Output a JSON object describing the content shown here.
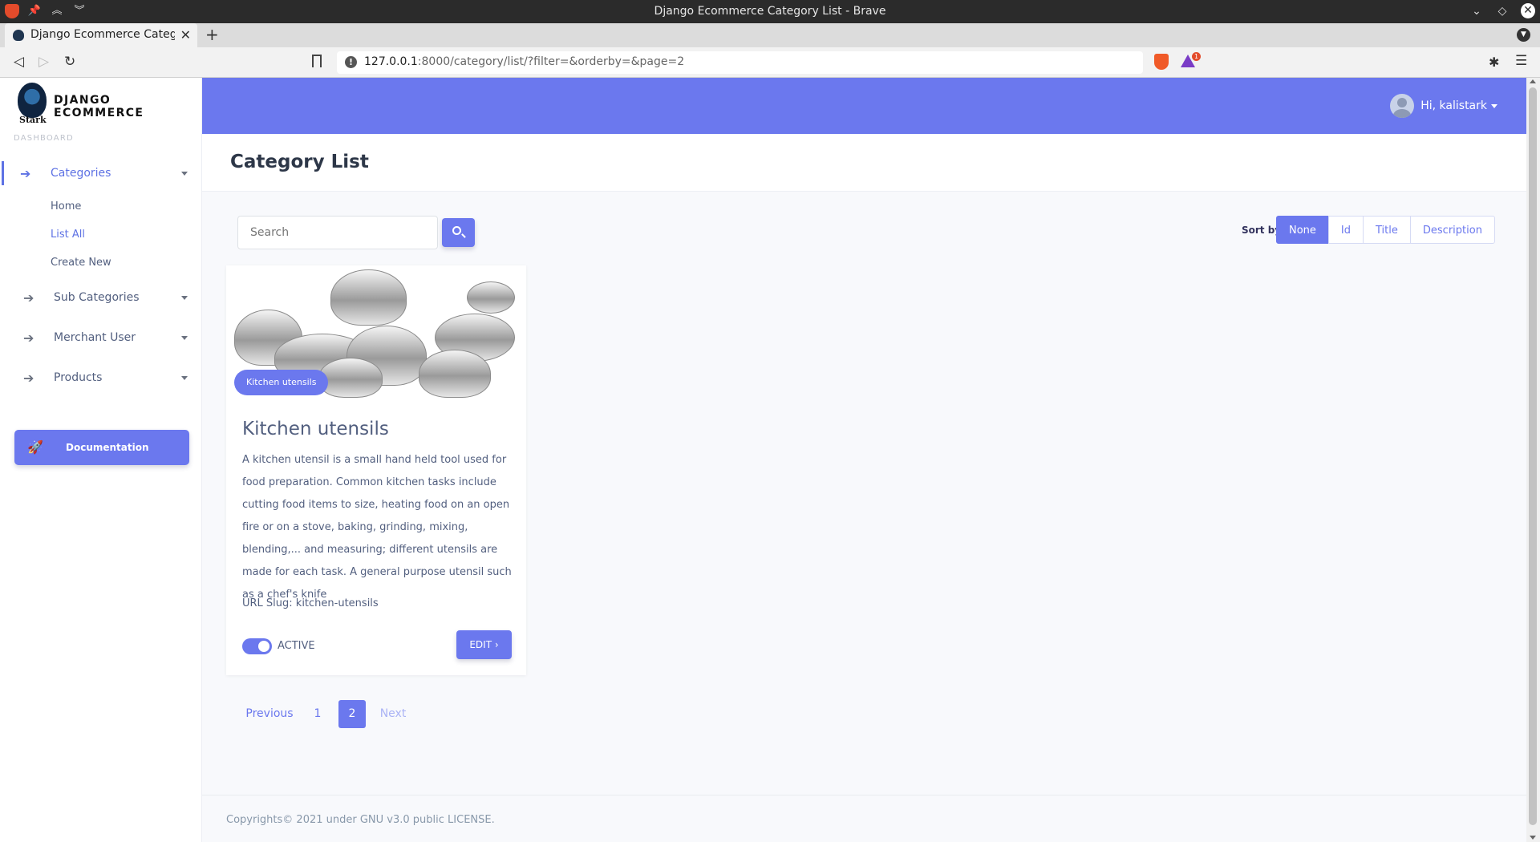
{
  "window": {
    "title": "Django Ecommerce Category List - Brave"
  },
  "tab": {
    "label": "Django Ecommerce Categor",
    "close": "✕",
    "new": "+"
  },
  "address": {
    "host": "127.0.0.1",
    "rest": ":8000/category/list/?filter=&orderby=&page=2",
    "rewards_badge": "1"
  },
  "brand": {
    "name": "DJANGO ECOMMERCE",
    "logo_text": "Stark"
  },
  "sidebar": {
    "section_label": "DASHBOARD",
    "items": [
      {
        "label": "Categories",
        "icon": "arrow-right-icon"
      },
      {
        "label": "Sub Categories",
        "icon": "arrow-right-icon"
      },
      {
        "label": "Merchant User",
        "icon": "arrow-right-icon"
      },
      {
        "label": "Products",
        "icon": "arrow-right-icon"
      }
    ],
    "subitems": [
      {
        "label": "Home"
      },
      {
        "label": "List All"
      },
      {
        "label": "Create New"
      }
    ],
    "documentation": "Documentation"
  },
  "user": {
    "greeting": "Hi, kalistark"
  },
  "page": {
    "title": "Category List"
  },
  "search": {
    "placeholder": "Search"
  },
  "sort": {
    "label": "Sort by",
    "options": [
      "None",
      "Id",
      "Title",
      "Description"
    ],
    "selected": "None"
  },
  "card": {
    "badge": "Kitchen utensils",
    "title": "Kitchen utensils",
    "description": "A kitchen utensil is a small hand held tool used for food preparation. Common kitchen tasks include cutting food items to size, heating food on an open fire or on a stove, baking, grinding, mixing, blending,... and measuring; different utensils are made for each task. A general purpose utensil such as a chef's knife",
    "slug": "URL Slug: kitchen-utensils",
    "status": "ACTIVE",
    "active": true,
    "edit": "EDIT ›"
  },
  "pagination": {
    "previous": "Previous",
    "pages": [
      "1",
      "2"
    ],
    "current": "2",
    "next": "Next"
  },
  "footer": {
    "text": "Copyrights© 2021 under GNU v3.0 public LICENSE."
  },
  "colors": {
    "accent": "#6b78ee",
    "text": "#525f7f"
  }
}
